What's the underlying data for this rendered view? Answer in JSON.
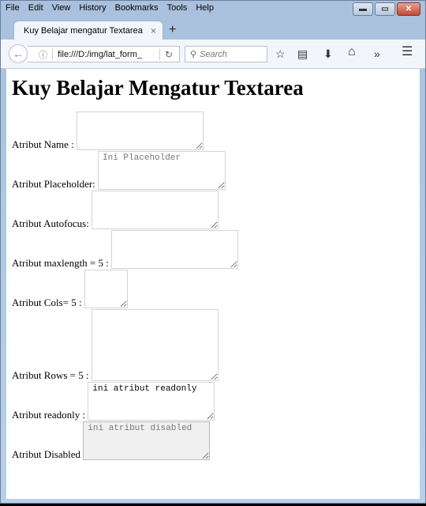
{
  "window": {
    "menu": [
      "File",
      "Edit",
      "View",
      "History",
      "Bookmarks",
      "Tools",
      "Help"
    ],
    "controls": {
      "minimize": "▬",
      "maximize": "▭",
      "close": "✕"
    }
  },
  "browser": {
    "tab_title": "Kuy Belajar mengatur Textarea",
    "tab_close": "×",
    "new_tab": "+",
    "back_icon": "←",
    "info_icon": "ⓘ",
    "url": "file:///D:/img/lat_form_",
    "reload_icon": "↻",
    "search_icon": "⚲",
    "search_placeholder": "Search",
    "toolbar_icons": {
      "bookmark": "☆",
      "reading_list": "▤",
      "downloads": "⬇",
      "home": "⌂",
      "overflow": "»",
      "menu": "☰"
    }
  },
  "page": {
    "heading": "Kuy Belajar Mengatur Textarea",
    "fields": [
      {
        "label": "Atribut Name :",
        "value": "",
        "placeholder": ""
      },
      {
        "label": "Atribut Placeholder:",
        "value": "",
        "placeholder": "Ini Placeholder"
      },
      {
        "label": "Atribut Autofocus:",
        "value": "",
        "placeholder": ""
      },
      {
        "label": "Atribut maxlength = 5 :",
        "value": "",
        "placeholder": ""
      },
      {
        "label": "Atribut Cols= 5 :",
        "value": "",
        "placeholder": ""
      },
      {
        "label": "Atribut Rows = 5 :",
        "value": "",
        "placeholder": ""
      },
      {
        "label": "Atribut readonly :",
        "value": "ini atribut readonly",
        "placeholder": ""
      },
      {
        "label": "Atribut Disabled",
        "value": "ini atribut disabled",
        "placeholder": ""
      }
    ]
  }
}
